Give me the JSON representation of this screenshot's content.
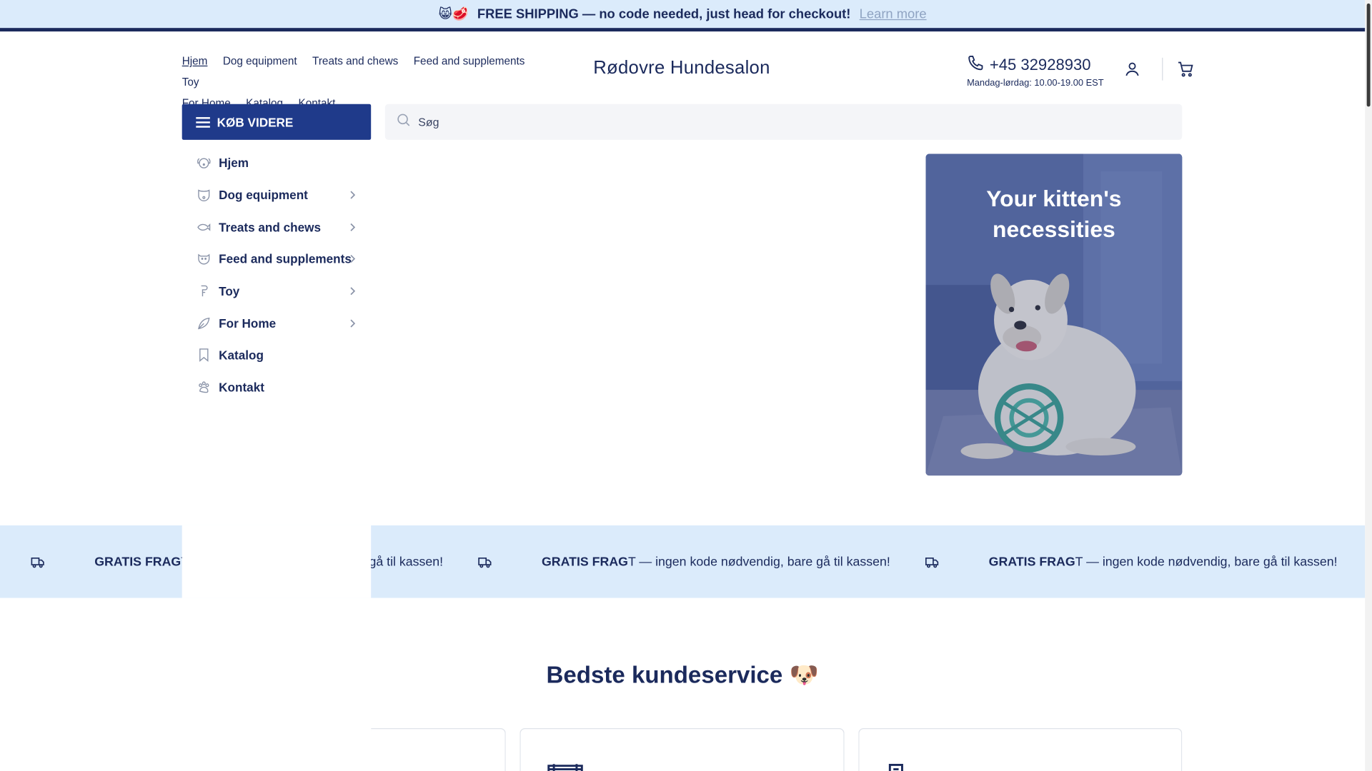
{
  "announcement": {
    "emoji": "😸🥩",
    "text": "FREE SHIPPING — no code needed, just head for checkout!",
    "link": "Learn more"
  },
  "topnav": {
    "items": [
      "Hjem",
      "Dog equipment",
      "Treats and chews",
      "Feed and supplements",
      "Toy",
      "For Home",
      "Katalog",
      "Kontakt"
    ]
  },
  "brand": {
    "name": "Rødovre Hundesalon"
  },
  "contact": {
    "phone": "+45 32928930",
    "hours": "Mandag-lørdag: 10.00-19.00 EST"
  },
  "buy_button": {
    "label": "KØB VIDERE"
  },
  "search": {
    "placeholder": "Søg"
  },
  "sidemenu": {
    "items": [
      {
        "label": "Hjem",
        "icon": "dog-face-icon",
        "has_children": false
      },
      {
        "label": "Dog equipment",
        "icon": "collar-icon",
        "has_children": true
      },
      {
        "label": "Treats and chews",
        "icon": "fish-icon",
        "has_children": true
      },
      {
        "label": "Feed and supplements",
        "icon": "bowl-icon",
        "has_children": true
      },
      {
        "label": "Toy",
        "icon": "toy-icon",
        "has_children": true
      },
      {
        "label": "For Home",
        "icon": "leaf-icon",
        "has_children": true
      },
      {
        "label": "Katalog",
        "icon": "bookmark-icon",
        "has_children": false
      },
      {
        "label": "Kontakt",
        "icon": "paw-icon",
        "has_children": false
      }
    ]
  },
  "hero": {
    "title_line1": "Your kitten's",
    "title_line2": "necessities"
  },
  "ticker": {
    "bold": "GRATIS FRAG",
    "rest": "T — ingen kode nødvendig, bare gå til kassen!",
    "partial_tail": "til kassen!"
  },
  "service": {
    "title": "Bedste kundeservice",
    "emoji": "🐶"
  },
  "colors": {
    "navy": "#1b2a5c",
    "button": "#1f3a8a",
    "light_blue": "#dbebfb"
  }
}
